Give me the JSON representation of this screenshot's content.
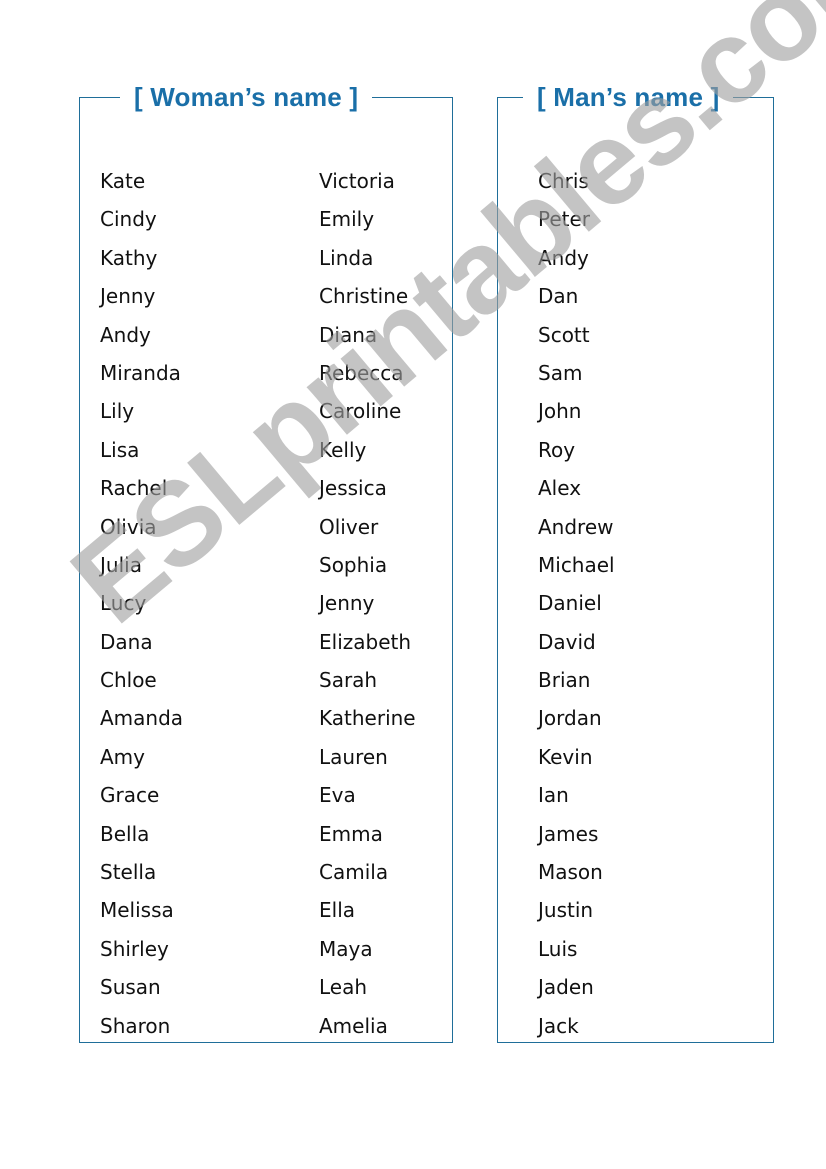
{
  "worksheet": {
    "woman_section": {
      "title": "[ Woman’s name ]",
      "column_1": [
        "Kate",
        "Cindy",
        "Kathy",
        "Jenny",
        "Andy",
        "Miranda",
        "Lily",
        "Lisa",
        "Rachel",
        "Olivia",
        "Julia",
        "Lucy",
        "Dana",
        "Chloe",
        "Amanda",
        "Amy",
        "Grace",
        "Bella",
        "Stella",
        "Melissa",
        "Shirley",
        "Susan",
        "Sharon"
      ],
      "column_2": [
        "Victoria",
        "Emily",
        "Linda",
        "Christine",
        "Diana",
        "Rebecca",
        "Caroline",
        "Kelly",
        "Jessica",
        "Oliver",
        "Sophia",
        "Jenny",
        "Elizabeth",
        "Sarah",
        "Katherine",
        "Lauren",
        "Eva",
        "Emma",
        "Camila",
        "Ella",
        "Maya",
        "Leah",
        "Amelia"
      ]
    },
    "man_section": {
      "title": "[ Man’s name ]",
      "column_1": [
        "Chris",
        "Peter",
        "Andy",
        "Dan",
        "Scott",
        "Sam",
        "John",
        "Roy",
        "Alex",
        "Andrew",
        "Michael",
        "Daniel",
        "David",
        "Brian",
        "Jordan",
        "Kevin",
        "Ian",
        "James",
        "Mason",
        "Justin",
        "Luis",
        "Jaden",
        "Jack"
      ]
    },
    "watermark": "ESLprintables.com",
    "colors": {
      "title": "#1a6fa8",
      "border": "#1f6e99",
      "text": "#111111",
      "watermark": "#a0a0a0"
    }
  }
}
